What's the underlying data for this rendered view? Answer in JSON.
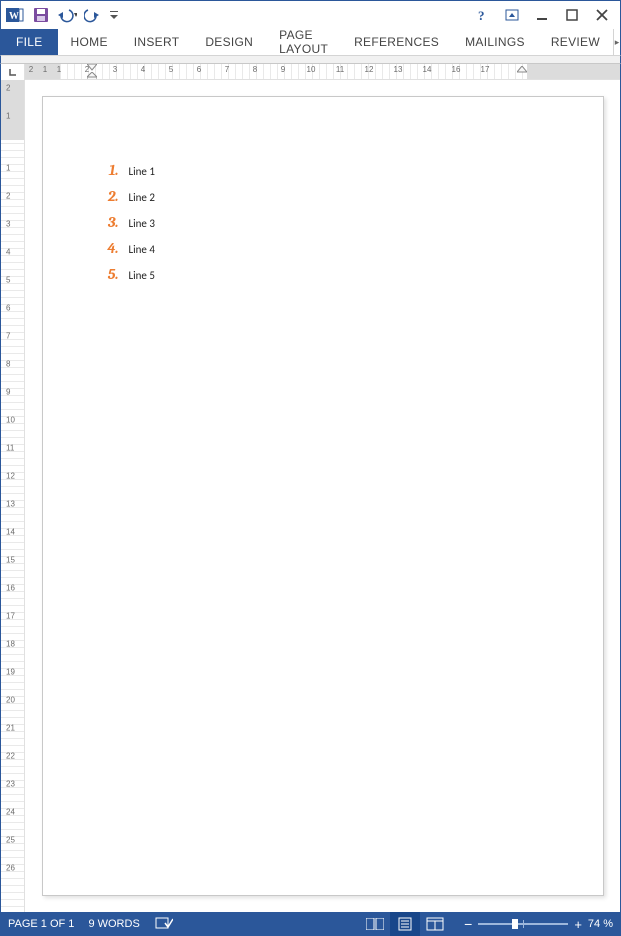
{
  "qat": {
    "icons": [
      "word-app-icon",
      "save-icon",
      "undo-icon",
      "redo-icon",
      "customize-qat-icon"
    ]
  },
  "window_controls": {
    "icons": [
      "help-icon",
      "ribbon-display-options-icon",
      "minimize-icon",
      "restore-icon",
      "close-icon"
    ]
  },
  "tabs": {
    "file": "FILE",
    "items": [
      "HOME",
      "INSERT",
      "DESIGN",
      "PAGE LAYOUT",
      "REFERENCES",
      "MAILINGS",
      "REVIEW"
    ]
  },
  "h_ruler": {
    "labels": [
      "2",
      "1",
      "1",
      "2",
      "3",
      "4",
      "5",
      "6",
      "7",
      "8",
      "9",
      "10",
      "11",
      "12",
      "13",
      "14",
      "16",
      "17"
    ]
  },
  "v_ruler": {
    "labels": [
      "2",
      "1",
      "1",
      "2",
      "3",
      "4",
      "5",
      "6",
      "7",
      "8",
      "9",
      "10",
      "11",
      "12",
      "13",
      "14",
      "15",
      "16",
      "17",
      "18",
      "19",
      "20",
      "21",
      "22",
      "23",
      "24",
      "25",
      "26"
    ]
  },
  "document": {
    "list": [
      {
        "num": "1.",
        "text": "Line 1"
      },
      {
        "num": "2.",
        "text": "Line 2"
      },
      {
        "num": "3.",
        "text": "Line 3"
      },
      {
        "num": "4.",
        "text": "Line 4"
      },
      {
        "num": "5.",
        "text": "Line 5"
      }
    ]
  },
  "status": {
    "page": "PAGE 1 OF 1",
    "words": "9 WORDS",
    "zoom": "74 %",
    "zoom_minus": "−",
    "zoom_plus": "+"
  }
}
